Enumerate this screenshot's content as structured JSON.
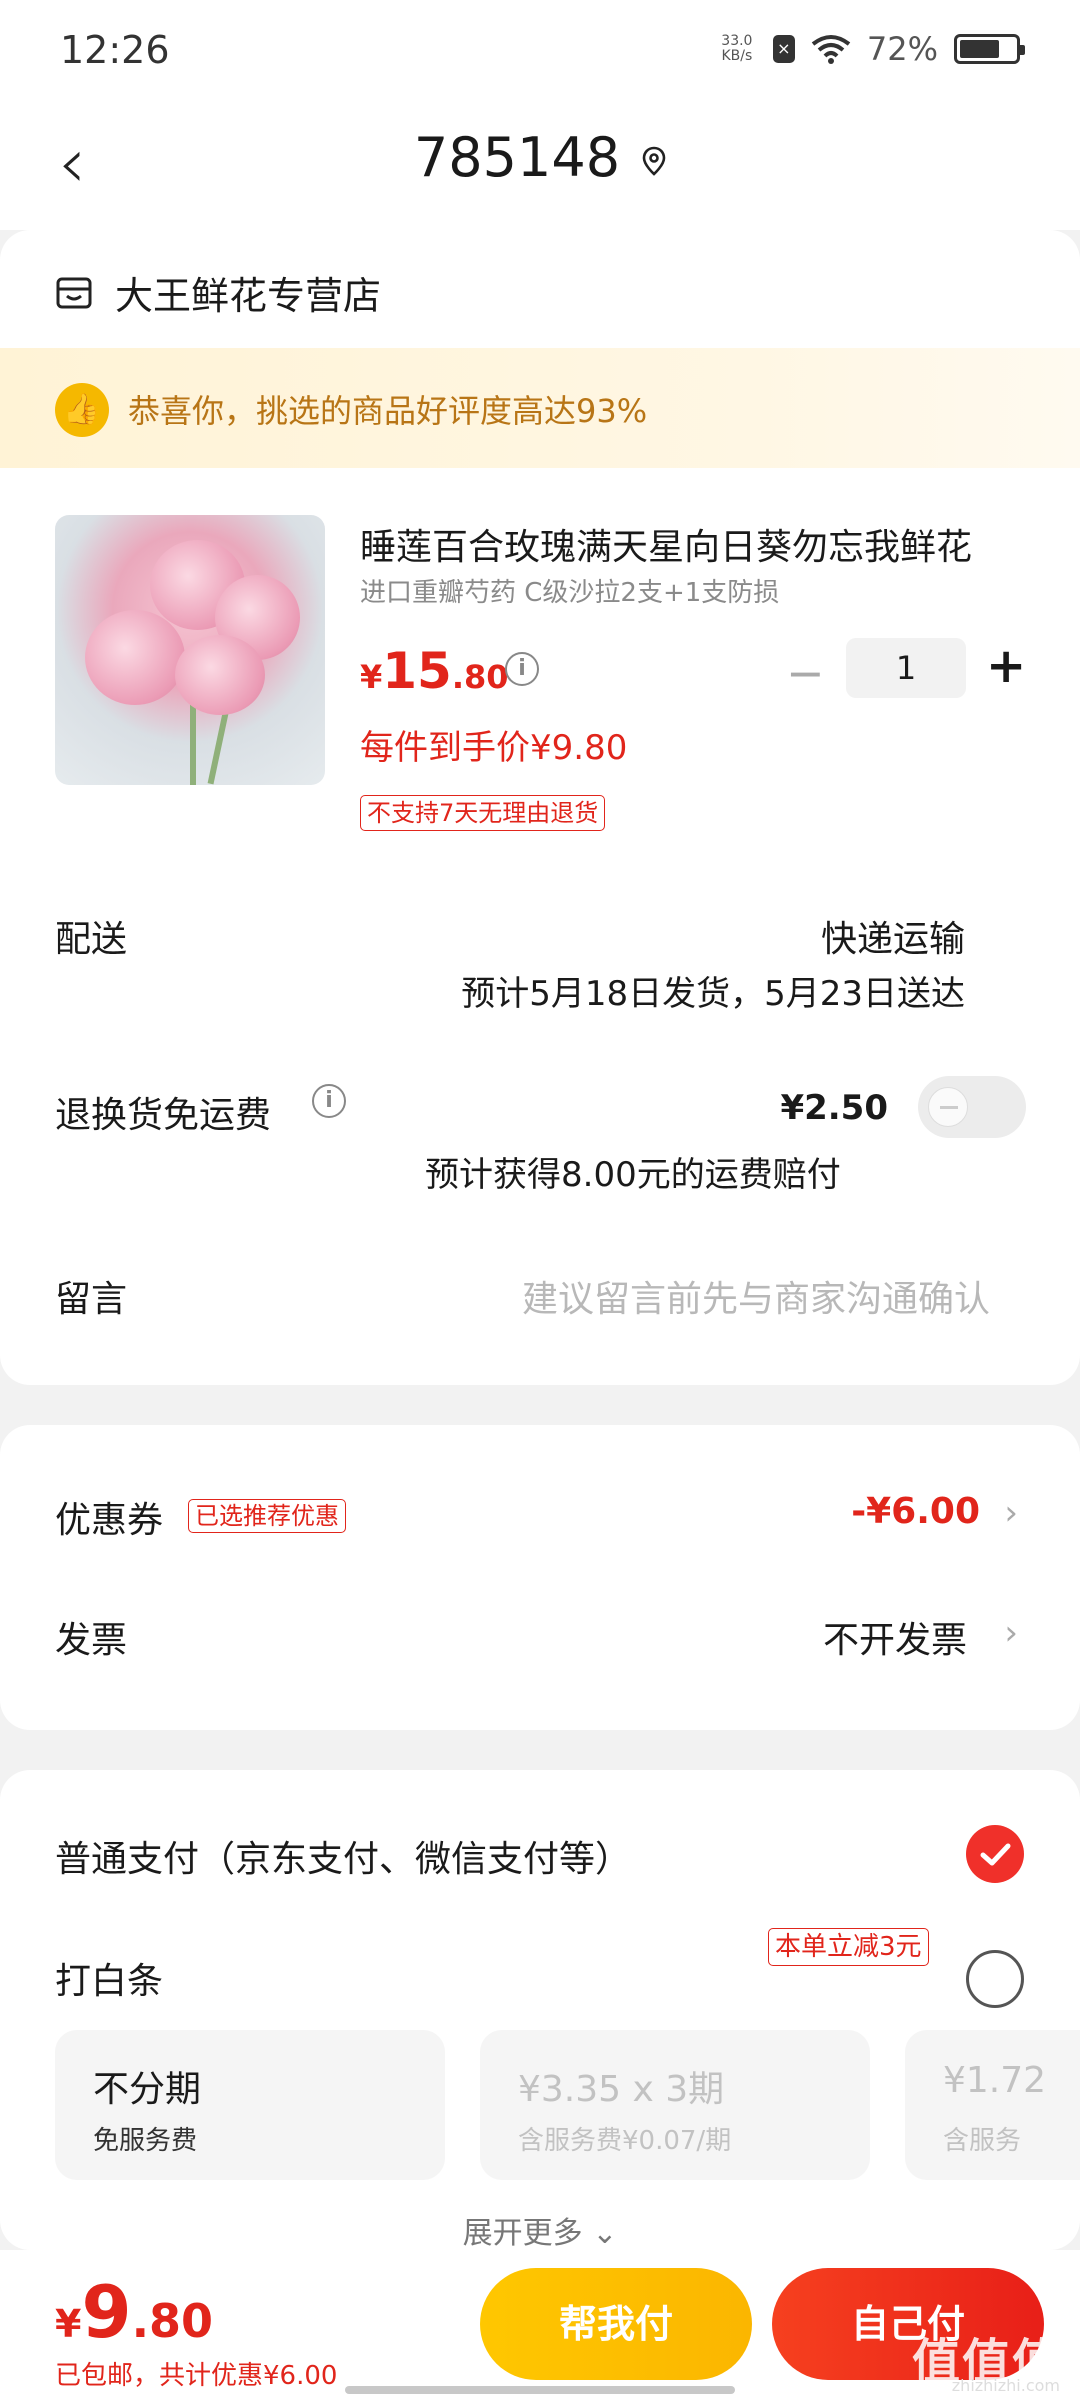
{
  "status_bar": {
    "time": "12:26",
    "net_speed": "33.0",
    "net_unit": "KB/s",
    "battery_pct": "72%",
    "battery_level": 0.72
  },
  "nav": {
    "title": "785148"
  },
  "store": {
    "name": "大王鲜花专营店"
  },
  "banner": {
    "text": "恭喜你，挑选的商品好评度高达93%"
  },
  "product": {
    "title": "睡莲百合玫瑰满天星向日葵勿忘我鲜花",
    "spec": "进口重瓣芍药 C级沙拉2支+1支防损",
    "price_symbol": "¥",
    "price_int": "15",
    "price_dec": ".80",
    "quantity": "1",
    "final_price": "每件到手价¥9.80",
    "return_policy": "不支持7天无理由退货"
  },
  "delivery": {
    "label": "配送",
    "method": "快递运输",
    "estimate": "预计5月18日发货，5月23日送达"
  },
  "return_insurance": {
    "label": "退换货免运费",
    "price": "¥2.50",
    "note": "预计获得8.00元的运费赔付",
    "enabled": false
  },
  "message": {
    "label": "留言",
    "placeholder": "建议留言前先与商家沟通确认"
  },
  "coupon": {
    "label": "优惠券",
    "tag": "已选推荐优惠",
    "value": "-¥6.00"
  },
  "invoice": {
    "label": "发票",
    "value": "不开发票"
  },
  "payment": {
    "normal_label": "普通支付（京东支付、微信支付等）",
    "baitiao_label": "打白条",
    "baitiao_tag": "本单立减3元",
    "installments": [
      {
        "title": "不分期",
        "sub": "免服务费"
      },
      {
        "title": "¥3.35 x 3期",
        "sub": "含服务费¥0.07/期"
      },
      {
        "title": "¥1.72",
        "sub": "含服务"
      }
    ],
    "expand_label": "展开更多"
  },
  "bottom": {
    "total_symbol": "¥",
    "total_int": "9",
    "total_dec": ".80",
    "summary": "已包邮，共计优惠¥6.00",
    "help_pay": "帮我付",
    "self_pay": "自己付"
  },
  "watermark": {
    "text": "值值值",
    "site": "zhizhizhi.com"
  },
  "colors": {
    "accent_red": "#e1251b",
    "help_yellow": "#ffc700",
    "banner_text": "#b87516"
  }
}
